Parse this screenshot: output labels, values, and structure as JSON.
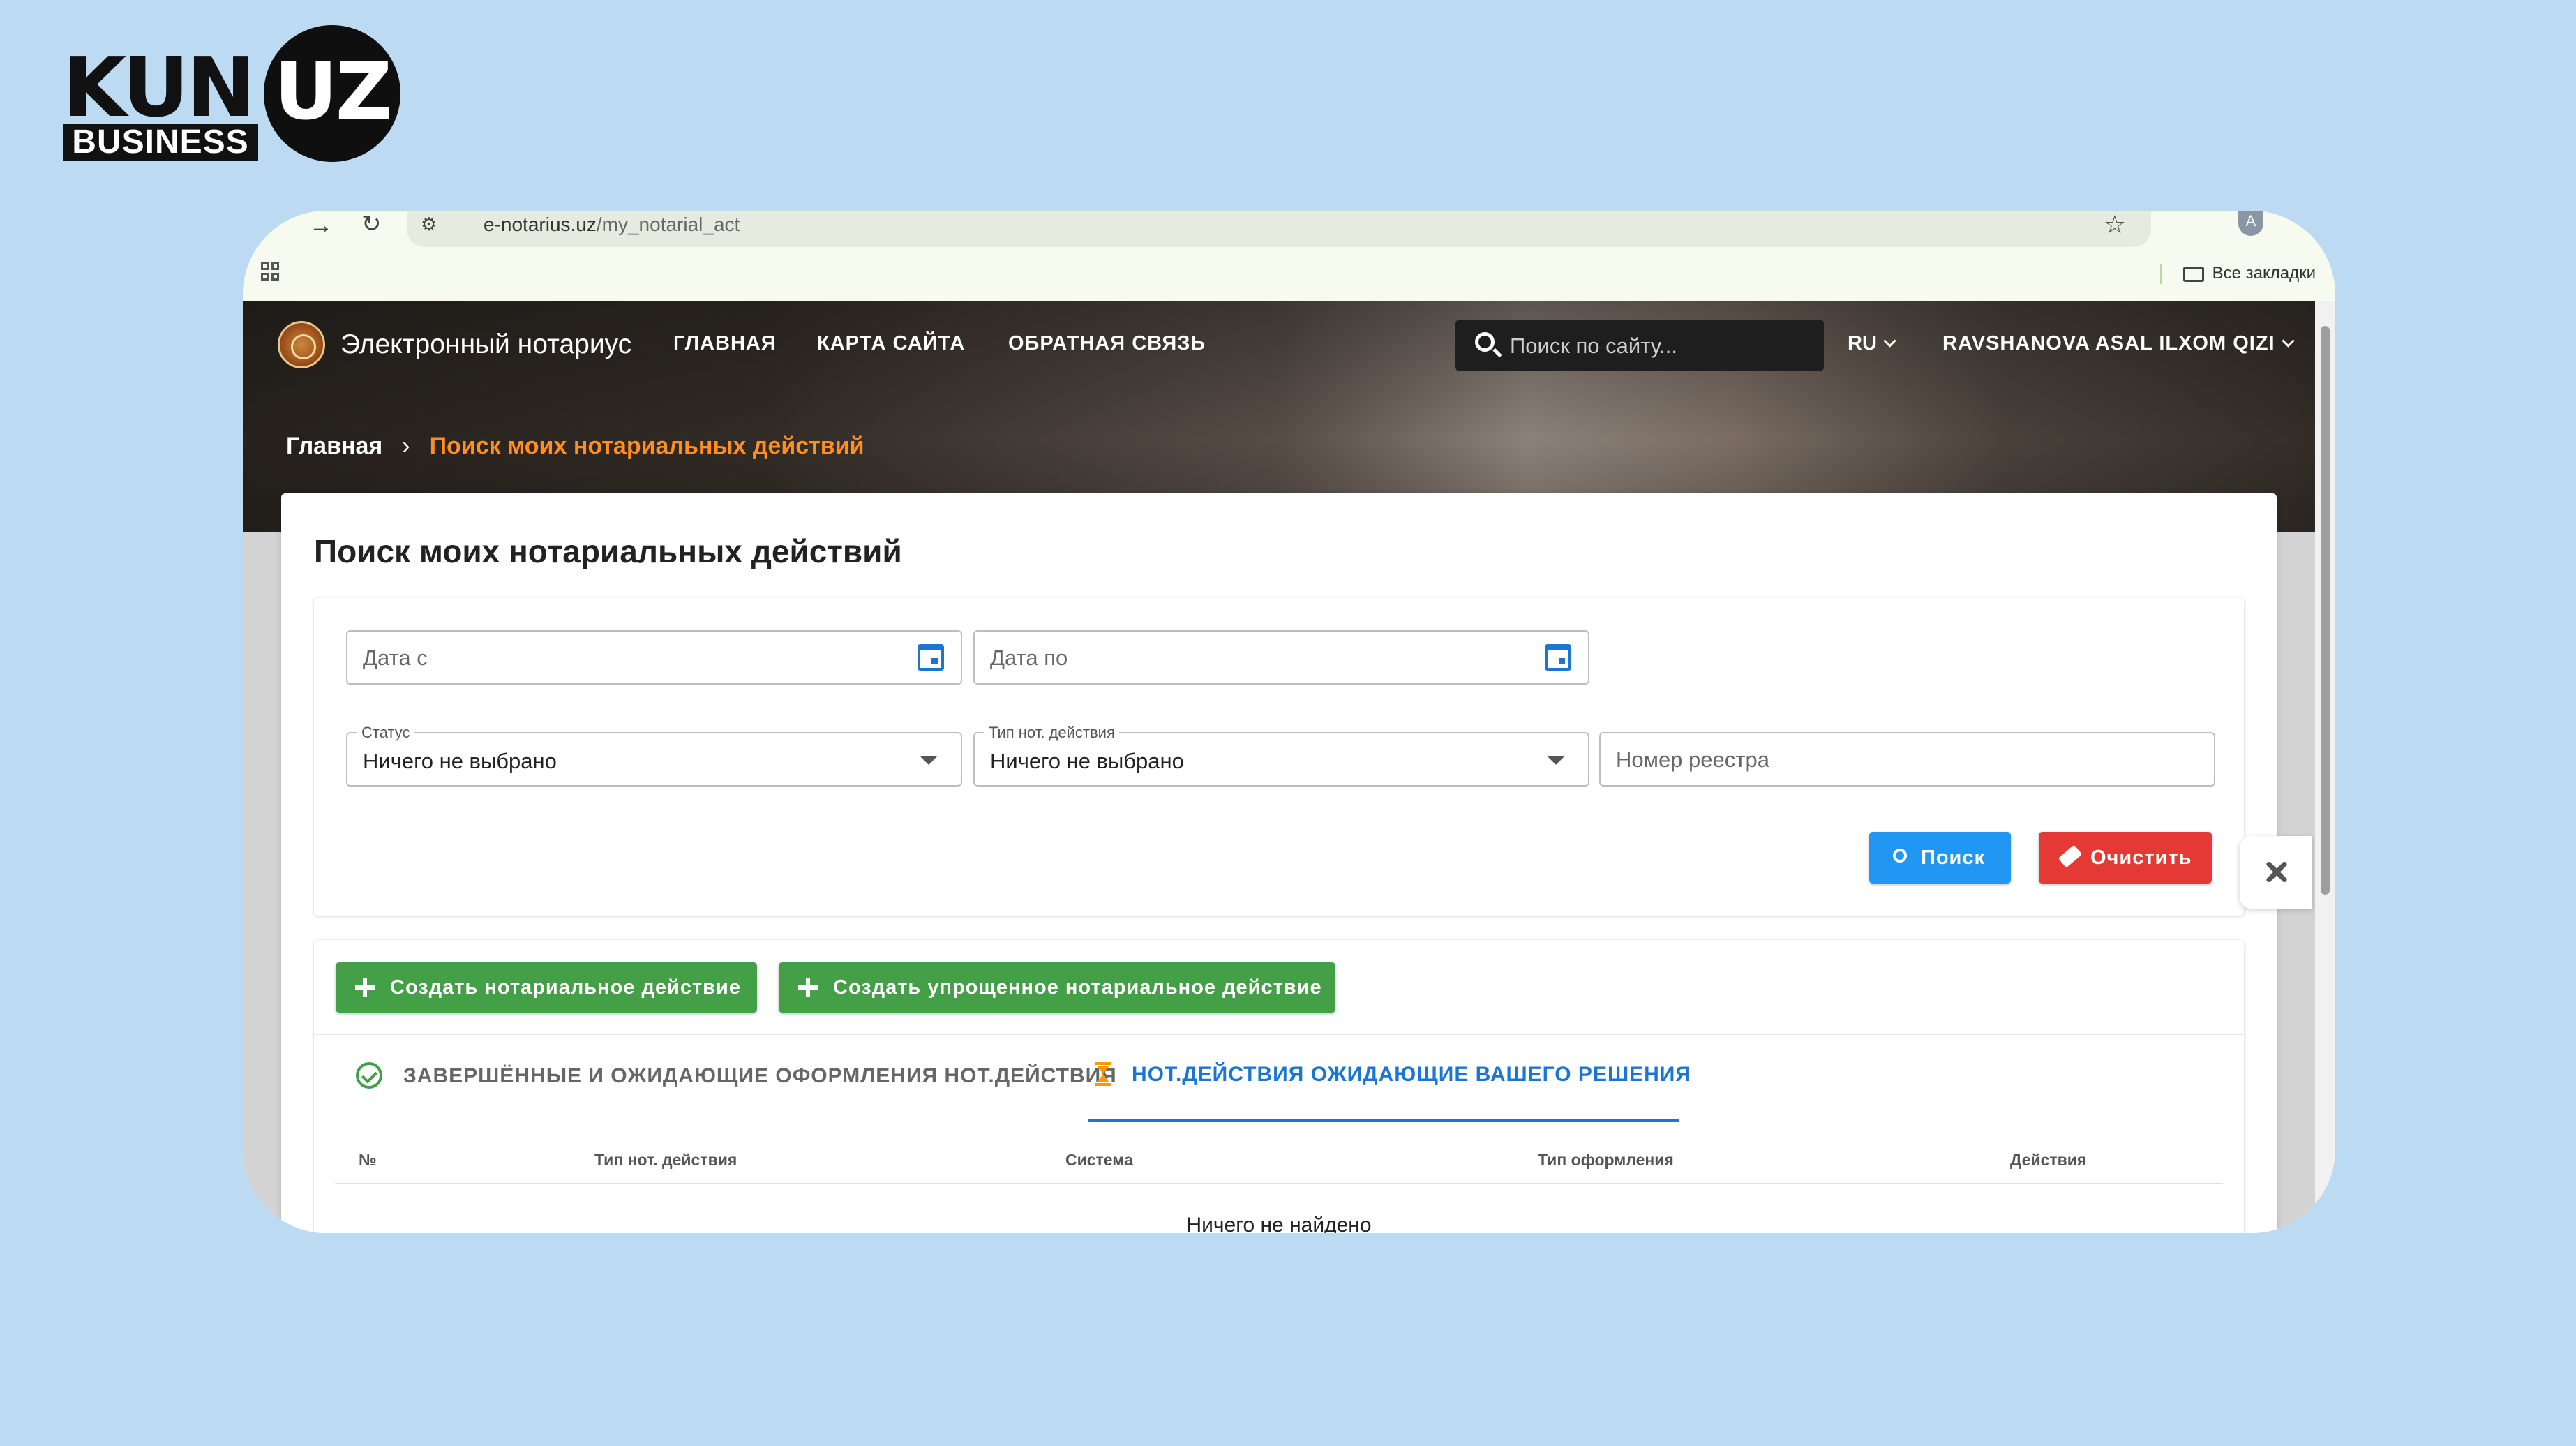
{
  "logo": {
    "kun": "KUN",
    "dot": ".",
    "uz": "UZ",
    "business": "BUSINESS"
  },
  "browser": {
    "url_host": "e-notarius.uz",
    "url_path": "/my_notarial_act",
    "profile_initial": "A",
    "bookmarks_label": "Все закладки"
  },
  "navbar": {
    "brand": "Электронный нотариус",
    "links": [
      "ГЛАВНАЯ",
      "КАРТА САЙТА",
      "ОБРАТНАЯ СВЯЗЬ"
    ],
    "search_placeholder": "Поиск по сайту...",
    "language": "RU",
    "user": "RAVSHANOVA ASAL ILXOM QIZI"
  },
  "breadcrumb": {
    "home": "Главная",
    "separator": "›",
    "current": "Поиск моих нотариальных действий"
  },
  "main": {
    "title": "Поиск моих нотариальных действий",
    "filters": {
      "date_from_placeholder": "Дата с",
      "date_to_placeholder": "Дата по",
      "status_label": "Статус",
      "status_value": "Ничего не выбрано",
      "type_label": "Тип нот. действия",
      "type_value": "Ничего не выбрано",
      "registry_placeholder": "Номер реестра",
      "search_button": "Поиск",
      "clear_button": "Очистить"
    },
    "actions": {
      "create_button": "Создать нотариальное действие",
      "create_simple_button": "Создать упрощенное нотариальное действие"
    },
    "tabs": [
      {
        "label": "ЗАВЕРШЁННЫЕ И ОЖИДАЮЩИЕ ОФОРМЛЕНИЯ НОТ.ДЕЙСТВИЯ",
        "active": false
      },
      {
        "label": "НОТ.ДЕЙСТВИЯ ОЖИДАЮЩИЕ ВАШЕГО РЕШЕНИЯ",
        "active": true
      }
    ],
    "table": {
      "columns": [
        "№",
        "Тип нот. действия",
        "Система",
        "Тип оформления",
        "Действия"
      ],
      "empty_text": "Ничего не найдено"
    }
  },
  "colors": {
    "accent": "#1976d2",
    "primary_button": "#2196f3",
    "danger_button": "#e53935",
    "success_button": "#43a047",
    "breadcrumb_active": "#ff8f20",
    "background": "#bcdbf3"
  }
}
